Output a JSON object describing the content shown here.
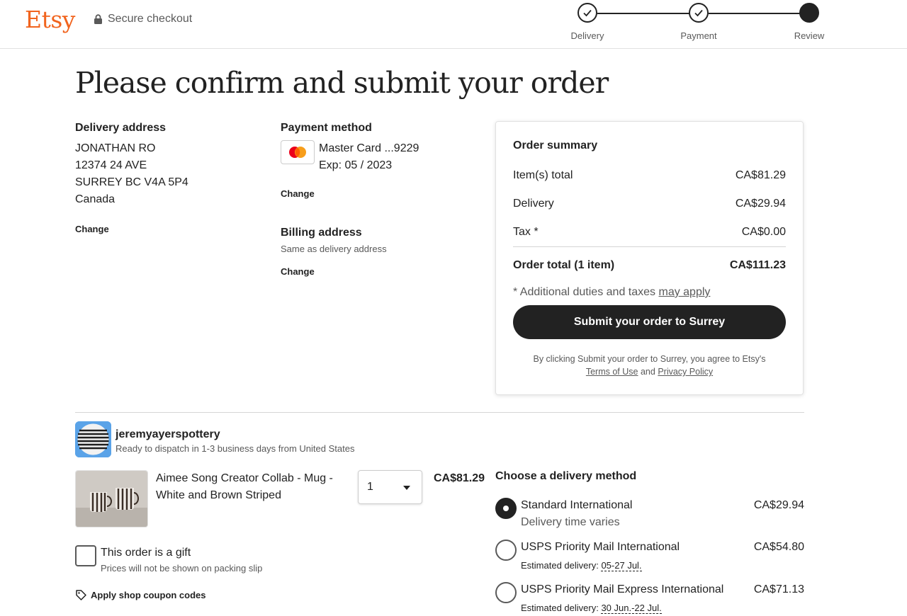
{
  "header": {
    "logo": "Etsy",
    "secure": "Secure checkout",
    "steps": [
      {
        "label": "Delivery",
        "state": "done"
      },
      {
        "label": "Payment",
        "state": "done"
      },
      {
        "label": "Review",
        "state": "current"
      }
    ]
  },
  "page": {
    "title": "Please confirm and submit your order"
  },
  "delivery_address": {
    "title": "Delivery address",
    "lines": [
      "JONATHAN RO",
      "12374 24 AVE",
      "SURREY BC V4A 5P4",
      "Canada"
    ],
    "change": "Change"
  },
  "payment": {
    "title": "Payment method",
    "card": "Master Card ...9229",
    "exp": "Exp: 05 / 2023",
    "change": "Change",
    "billing_title": "Billing address",
    "billing_sub": "Same as delivery address",
    "billing_change": "Change"
  },
  "summary": {
    "title": "Order summary",
    "rows": [
      {
        "label": "Item(s) total",
        "value": "CA$81.29"
      },
      {
        "label": "Delivery",
        "value": "CA$29.94"
      },
      {
        "label": "Tax *",
        "value": "CA$0.00"
      }
    ],
    "total_label": "Order total (1 item)",
    "total_value": "CA$111.23",
    "duties_text": "* Additional duties and taxes",
    "duties_link": "may apply",
    "submit": "Submit your order to Surrey",
    "legal_text": "By clicking Submit your order to Surrey, you agree to Etsy's",
    "terms": "Terms of Use",
    "and": "and",
    "privacy": "Privacy Policy"
  },
  "shop": {
    "name": "jeremyayerspottery",
    "dispatch": "Ready to dispatch in 1-3 business days from United States",
    "item": {
      "title": "Aimee Song Creator Collab - Mug - White and Brown Striped",
      "quantity": "1",
      "price": "CA$81.29"
    },
    "gift_label": "This order is a gift",
    "gift_sub": "Prices will not be shown on packing slip",
    "coupon": "Apply shop coupon codes"
  },
  "delivery_methods": {
    "title": "Choose a delivery method",
    "options": [
      {
        "name": "Standard International",
        "price": "CA$29.94",
        "sub": "Delivery time varies",
        "selected": true
      },
      {
        "name": "USPS Priority Mail International",
        "price": "CA$54.80",
        "est_label": "Estimated delivery:",
        "est_date": "05-27 Jul.",
        "selected": false
      },
      {
        "name": "USPS Priority Mail Express International",
        "price": "CA$71.13",
        "est_label": "Estimated delivery:",
        "est_date": "30 Jun.-22 Jul.",
        "selected": false
      }
    ]
  },
  "colors": {
    "brand": "#f1641e",
    "primary": "#222222",
    "muted": "#595959"
  }
}
